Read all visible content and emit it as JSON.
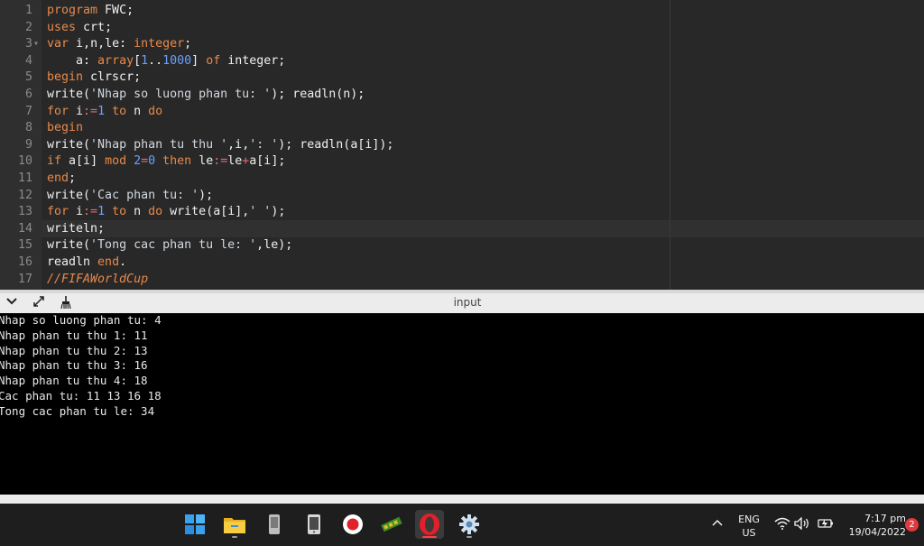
{
  "editor": {
    "lines": [
      {
        "n": "1",
        "tokens": [
          [
            "kw",
            "program"
          ],
          [
            "id",
            " FWC"
          ],
          [
            "pn",
            ";"
          ]
        ]
      },
      {
        "n": "2",
        "tokens": [
          [
            "kw",
            "uses"
          ],
          [
            "id",
            " crt"
          ],
          [
            "pn",
            ";"
          ]
        ]
      },
      {
        "n": "3",
        "fold": true,
        "tokens": [
          [
            "kw",
            "var"
          ],
          [
            "id",
            " i"
          ],
          [
            "pn",
            ","
          ],
          [
            "id",
            "n"
          ],
          [
            "pn",
            ","
          ],
          [
            "id",
            "le"
          ],
          [
            "pn",
            ":"
          ],
          [
            "kw",
            " integer"
          ],
          [
            "pn",
            ";"
          ]
        ]
      },
      {
        "n": "4",
        "tokens": [
          [
            "id",
            "    a"
          ],
          [
            "pn",
            ":"
          ],
          [
            "kw",
            " array"
          ],
          [
            "pn",
            "["
          ],
          [
            "num",
            "1"
          ],
          [
            "pn",
            ".."
          ],
          [
            "num",
            "1000"
          ],
          [
            "pn",
            "]"
          ],
          [
            "kw",
            " of"
          ],
          [
            "id",
            " integer"
          ],
          [
            "pn",
            ";"
          ]
        ]
      },
      {
        "n": "5",
        "tokens": [
          [
            "kw",
            "begin"
          ],
          [
            "id",
            " clrscr"
          ],
          [
            "pn",
            ";"
          ]
        ]
      },
      {
        "n": "6",
        "tokens": [
          [
            "id",
            "write"
          ],
          [
            "pn",
            "("
          ],
          [
            "str",
            "'Nhap so luong phan tu: '"
          ],
          [
            "pn",
            ");"
          ],
          [
            "id",
            " readln"
          ],
          [
            "pn",
            "("
          ],
          [
            "id",
            "n"
          ],
          [
            "pn",
            ");"
          ]
        ]
      },
      {
        "n": "7",
        "tokens": [
          [
            "kw",
            "for"
          ],
          [
            "id",
            " i"
          ],
          [
            "op",
            ":="
          ],
          [
            "num",
            "1"
          ],
          [
            "kw",
            " to"
          ],
          [
            "id",
            " n"
          ],
          [
            "kw",
            " do"
          ]
        ]
      },
      {
        "n": "8",
        "tokens": [
          [
            "kw",
            "begin"
          ]
        ]
      },
      {
        "n": "9",
        "tokens": [
          [
            "id",
            "write"
          ],
          [
            "pn",
            "("
          ],
          [
            "str",
            "'Nhap phan tu thu '"
          ],
          [
            "pn",
            ","
          ],
          [
            "id",
            "i"
          ],
          [
            "pn",
            ","
          ],
          [
            "str",
            "': '"
          ],
          [
            "pn",
            ");"
          ],
          [
            "id",
            " readln"
          ],
          [
            "pn",
            "("
          ],
          [
            "id",
            "a"
          ],
          [
            "pn",
            "["
          ],
          [
            "id",
            "i"
          ],
          [
            "pn",
            "]);"
          ]
        ]
      },
      {
        "n": "10",
        "tokens": [
          [
            "kw",
            "if"
          ],
          [
            "id",
            " a"
          ],
          [
            "pn",
            "["
          ],
          [
            "id",
            "i"
          ],
          [
            "pn",
            "]"
          ],
          [
            "kw",
            " mod"
          ],
          [
            "num",
            " 2"
          ],
          [
            "op",
            "="
          ],
          [
            "num",
            "0"
          ],
          [
            "kw",
            " then"
          ],
          [
            "id",
            " le"
          ],
          [
            "op",
            ":="
          ],
          [
            "id",
            "le"
          ],
          [
            "op",
            "+"
          ],
          [
            "id",
            "a"
          ],
          [
            "pn",
            "["
          ],
          [
            "id",
            "i"
          ],
          [
            "pn",
            "];"
          ]
        ]
      },
      {
        "n": "11",
        "tokens": [
          [
            "kw",
            "end"
          ],
          [
            "pn",
            ";"
          ]
        ]
      },
      {
        "n": "12",
        "tokens": [
          [
            "id",
            "write"
          ],
          [
            "pn",
            "("
          ],
          [
            "str",
            "'Cac phan tu: '"
          ],
          [
            "pn",
            ");"
          ]
        ]
      },
      {
        "n": "13",
        "tokens": [
          [
            "kw",
            "for"
          ],
          [
            "id",
            " i"
          ],
          [
            "op",
            ":="
          ],
          [
            "num",
            "1"
          ],
          [
            "kw",
            " to"
          ],
          [
            "id",
            " n"
          ],
          [
            "kw",
            " do"
          ],
          [
            "id",
            " write"
          ],
          [
            "pn",
            "("
          ],
          [
            "id",
            "a"
          ],
          [
            "pn",
            "["
          ],
          [
            "id",
            "i"
          ],
          [
            "pn",
            "],"
          ],
          [
            "str",
            "' '"
          ],
          [
            "pn",
            ");"
          ]
        ]
      },
      {
        "n": "14",
        "tokens": [
          [
            "id",
            "writeln"
          ],
          [
            "pn",
            ";"
          ]
        ]
      },
      {
        "n": "15",
        "tokens": [
          [
            "id",
            "write"
          ],
          [
            "pn",
            "("
          ],
          [
            "str",
            "'Tong cac phan tu le: '"
          ],
          [
            "pn",
            ","
          ],
          [
            "id",
            "le"
          ],
          [
            "pn",
            ");"
          ]
        ]
      },
      {
        "n": "16",
        "tokens": [
          [
            "id",
            "readln"
          ],
          [
            "kw",
            " end"
          ],
          [
            "pn",
            "."
          ]
        ]
      },
      {
        "n": "17",
        "tokens": [
          [
            "cm",
            "//FIFAWorldCup"
          ]
        ]
      }
    ]
  },
  "io_panel": {
    "title": "input",
    "collapse_icon": "chevron-down-icon",
    "expand_icon": "expand-arrows-icon",
    "clear_icon": "broom-icon"
  },
  "console": {
    "lines": [
      "Nhap so luong phan tu: 4",
      "Nhap phan tu thu 1: 11",
      "Nhap phan tu thu 2: 13",
      "Nhap phan tu thu 3: 16",
      "Nhap phan tu thu 4: 18",
      "Cac phan tu: 11 13 16 18",
      "Tong cac phan tu le: 34"
    ]
  },
  "taskbar": {
    "apps": [
      {
        "name": "windows-start-icon"
      },
      {
        "name": "file-explorer-icon"
      },
      {
        "name": "phone-device-icon"
      },
      {
        "name": "mobile-phone-icon"
      },
      {
        "name": "screen-recorder-icon"
      },
      {
        "name": "memory-module-icon"
      },
      {
        "name": "opera-browser-icon",
        "active": true
      },
      {
        "name": "settings-gear-icon"
      }
    ],
    "language_top": "ENG",
    "language_bottom": "US",
    "time": "7:17 pm",
    "date": "19/04/2022",
    "notification_count": "2"
  },
  "colors": {
    "keyword": "#e8894a",
    "number": "#6aa0ff",
    "operator": "#e06c75",
    "notification": "#e0393e"
  }
}
